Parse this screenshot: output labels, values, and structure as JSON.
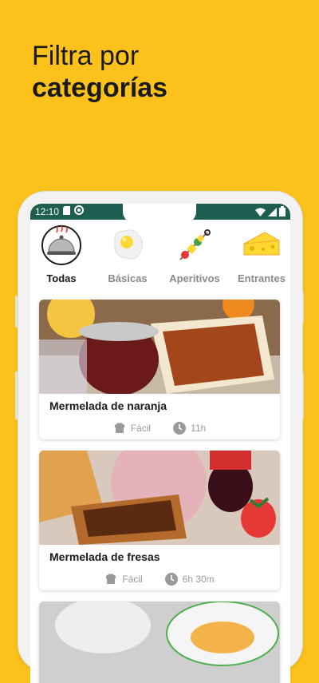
{
  "headline": {
    "line1": "Filtra por",
    "line2": "categorías"
  },
  "status": {
    "time": "12:10"
  },
  "categories": [
    {
      "label": "Todas",
      "icon": "serving-cloche-icon",
      "active": true
    },
    {
      "label": "Básicas",
      "icon": "fried-egg-icon",
      "active": false
    },
    {
      "label": "Aperitivos",
      "icon": "skewer-icon",
      "active": false
    },
    {
      "label": "Entrantes",
      "icon": "cheese-icon",
      "active": false
    }
  ],
  "recipes": [
    {
      "title": "Mermelada de naranja",
      "difficulty": "Fácil",
      "time": "11h"
    },
    {
      "title": "Mermelada de fresas",
      "difficulty": "Fácil",
      "time": "6h 30m"
    }
  ],
  "colors": {
    "background": "#FCC21B",
    "statusbar": "#1e5e50"
  }
}
